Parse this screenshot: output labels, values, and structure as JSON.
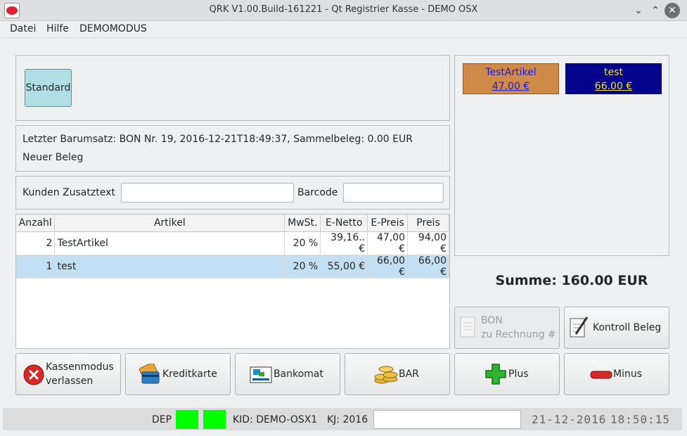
{
  "window": {
    "title": "QRK V1.00.Build-161221 - Qt Registrier Kasse - DEMO OSX"
  },
  "menu": {
    "file": "Datei",
    "help": "Hilfe",
    "demo": "DEMOMODUS"
  },
  "categories": {
    "standard": "Standard"
  },
  "info": {
    "last_receipt": "Letzter Barumsatz: BON Nr. 19, 2016-12-21T18:49:37, Sammelbeleg: 0.00 EUR",
    "new_receipt": "Neuer Beleg"
  },
  "customer": {
    "extra_label": "Kunden Zusatztext",
    "extra_value": "",
    "barcode_label": "Barcode",
    "barcode_value": ""
  },
  "table": {
    "headers": [
      "Anzahl",
      "Artikel",
      "MwSt.",
      "E-Netto",
      "E-Preis",
      "Preis"
    ],
    "rows": [
      [
        "2",
        "TestArtikel",
        "20 %",
        "39,16.. €",
        "47,00 €",
        "94,00 €"
      ],
      [
        "1",
        "test",
        "20 %",
        "55,00 €",
        "66,00 €",
        "66,00 €"
      ]
    ]
  },
  "products": [
    {
      "name": "TestArtikel",
      "price": "47.00 €",
      "bg": "#d08a47",
      "fg": "#1a1ad8"
    },
    {
      "name": "test",
      "price": "66.00 €",
      "bg": "#04048c",
      "fg": "#f0e020"
    }
  ],
  "summary": {
    "total": "Summe: 160.00 EUR"
  },
  "actions": {
    "bon_line1": "BON",
    "bon_line2": "zu Rechnung #",
    "control_receipt": "Kontroll Beleg",
    "exit_line1": "Kassenmodus",
    "exit_line2": "verlassen",
    "credit_card": "Kreditkarte",
    "bankomat": "Bankomat",
    "cash": "BAR",
    "plus": "Plus",
    "minus": "Minus"
  },
  "status": {
    "dep": "DEP",
    "kid": "KID: DEMO-OSX1",
    "kj": "KJ: 2016",
    "date": "21-12-2016",
    "time": "18:50:15",
    "indicator_color": "#00ff00"
  }
}
